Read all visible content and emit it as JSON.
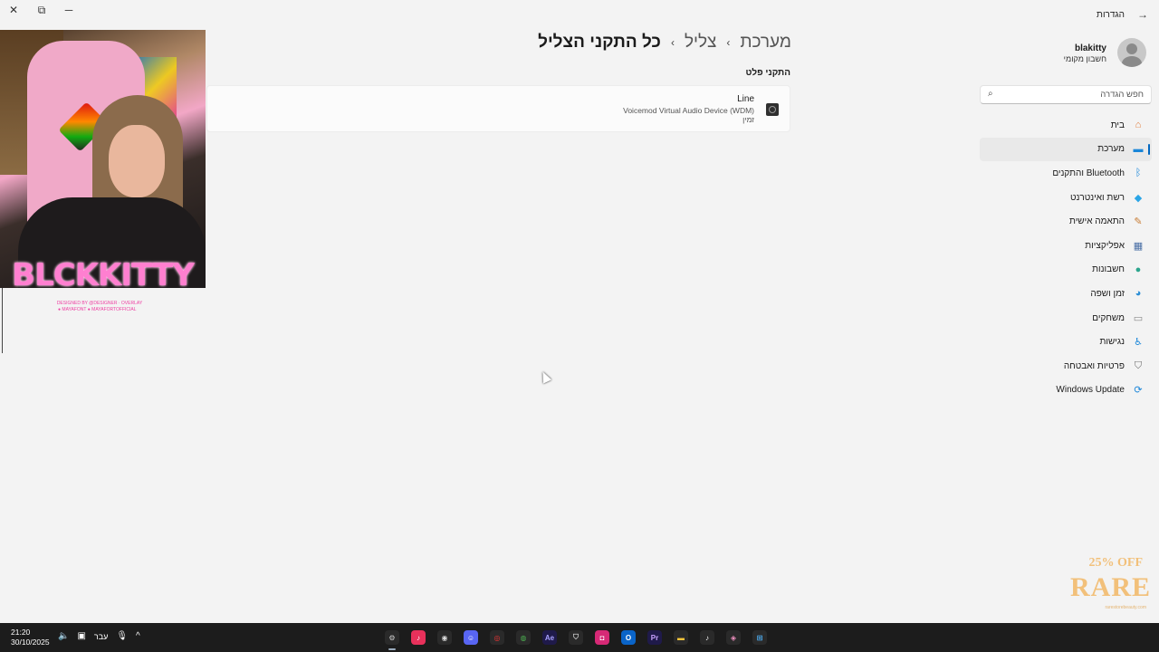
{
  "window": {
    "title": "הגדרות",
    "close_glyph": "✕",
    "maximize_glyph": "⧉",
    "minimize_glyph": "─",
    "back_glyph": "→"
  },
  "profile": {
    "name": "blakitty",
    "account_type": "חשבון מקומי"
  },
  "search": {
    "placeholder": "חפש הגדרה"
  },
  "nav": {
    "items": [
      {
        "label": "בית",
        "icon": "home-icon",
        "glyph": "⌂",
        "color": "#e07b39",
        "active": false
      },
      {
        "label": "מערכת",
        "icon": "system-icon",
        "glyph": "▬",
        "color": "#1a86d9",
        "active": true
      },
      {
        "label": "Bluetooth והתקנים",
        "icon": "bluetooth-icon",
        "glyph": "ᛒ",
        "color": "#1a86d9",
        "active": false
      },
      {
        "label": "רשת ואינטרנט",
        "icon": "network-icon",
        "glyph": "◆",
        "color": "#2aa5e6",
        "active": false
      },
      {
        "label": "התאמה אישית",
        "icon": "personalization-icon",
        "glyph": "✎",
        "color": "#c77b33",
        "active": false
      },
      {
        "label": "אפליקציות",
        "icon": "apps-icon",
        "glyph": "▦",
        "color": "#4a6fa5",
        "active": false
      },
      {
        "label": "חשבונות",
        "icon": "accounts-icon",
        "glyph": "●",
        "color": "#2ca58d",
        "active": false
      },
      {
        "label": "זמן ושפה",
        "icon": "time-language-icon",
        "glyph": "◕",
        "color": "#2b8ed6",
        "active": false
      },
      {
        "label": "משחקים",
        "icon": "gaming-icon",
        "glyph": "▭",
        "color": "#8a8a8a",
        "active": false
      },
      {
        "label": "נגישות",
        "icon": "accessibility-icon",
        "glyph": "♿",
        "color": "#1a86d9",
        "active": false
      },
      {
        "label": "פרטיות ואבטחה",
        "icon": "privacy-shield-icon",
        "glyph": "⛉",
        "color": "#6e6e6e",
        "active": false
      },
      {
        "label": "Windows Update",
        "icon": "windows-update-icon",
        "glyph": "⟳",
        "color": "#1a86d9",
        "active": false
      }
    ]
  },
  "breadcrumb": {
    "items": [
      "מערכת",
      "צליל",
      "כל התקני הצליל"
    ],
    "separator": "›"
  },
  "section": {
    "title": "התקני פלט"
  },
  "device": {
    "name": "Line",
    "description": "Voicemod Virtual Audio Device (WDM)",
    "status": "זמין"
  },
  "overlay": {
    "streamer_name": "BLCKKITTY",
    "subtitle": "DESIGNED BY @DESIGNER · OVERLAY",
    "handles": "● MAYAFONT ● MAYAFORTOFFICIAL"
  },
  "watermark": {
    "line1": "25% OFF",
    "line2": "RARE",
    "line3": "rarestorebeauty.com"
  },
  "taskbar": {
    "time": "21:20",
    "date": "30/10/2025",
    "language": "עבר",
    "volume_glyph": "🔈",
    "network_glyph": "▣",
    "mic_glyph": "🎙",
    "chevron_glyph": "^",
    "apps": [
      {
        "name": "settings-icon",
        "label": "⚙",
        "bg": "#2a2a2a",
        "fg": "#ccc",
        "active": true
      },
      {
        "name": "tiktok-live-icon",
        "label": "♪",
        "bg": "#e8315b",
        "fg": "#fff",
        "active": false
      },
      {
        "name": "obs-icon",
        "label": "◉",
        "bg": "#2a2a2a",
        "fg": "#ddd",
        "active": false
      },
      {
        "name": "discord-icon",
        "label": "☺",
        "bg": "#5865f2",
        "fg": "#fff",
        "active": false
      },
      {
        "name": "streamlabs-icon",
        "label": "◎",
        "bg": "#2a2a2a",
        "fg": "#e33",
        "active": false
      },
      {
        "name": "chrome-icon",
        "label": "◍",
        "bg": "#2a2a2a",
        "fg": "#4caf50",
        "active": false
      },
      {
        "name": "after-effects-icon",
        "label": "Ae",
        "bg": "#1f1a4a",
        "fg": "#a9a2ff",
        "active": false
      },
      {
        "name": "security-shield-icon",
        "label": "⛉",
        "bg": "#2a2a2a",
        "fg": "#ccc",
        "active": false
      },
      {
        "name": "instagram-icon",
        "label": "◘",
        "bg": "#d62976",
        "fg": "#fff",
        "active": false
      },
      {
        "name": "outlook-icon",
        "label": "O",
        "bg": "#0a64c8",
        "fg": "#fff",
        "active": false
      },
      {
        "name": "premiere-icon",
        "label": "Pr",
        "bg": "#1f1a4a",
        "fg": "#c8a2ff",
        "active": false
      },
      {
        "name": "file-explorer-icon",
        "label": "▬",
        "bg": "#2a2a2a",
        "fg": "#f5c33b",
        "active": false
      },
      {
        "name": "tiktok-icon",
        "label": "♪",
        "bg": "#2a2a2a",
        "fg": "#fff",
        "active": false
      },
      {
        "name": "copilot-icon",
        "label": "◈",
        "bg": "#2a2a2a",
        "fg": "#f090c0",
        "active": false
      },
      {
        "name": "start-icon",
        "label": "⊞",
        "bg": "#2a2a2a",
        "fg": "#4fb6ff",
        "active": false
      }
    ]
  }
}
